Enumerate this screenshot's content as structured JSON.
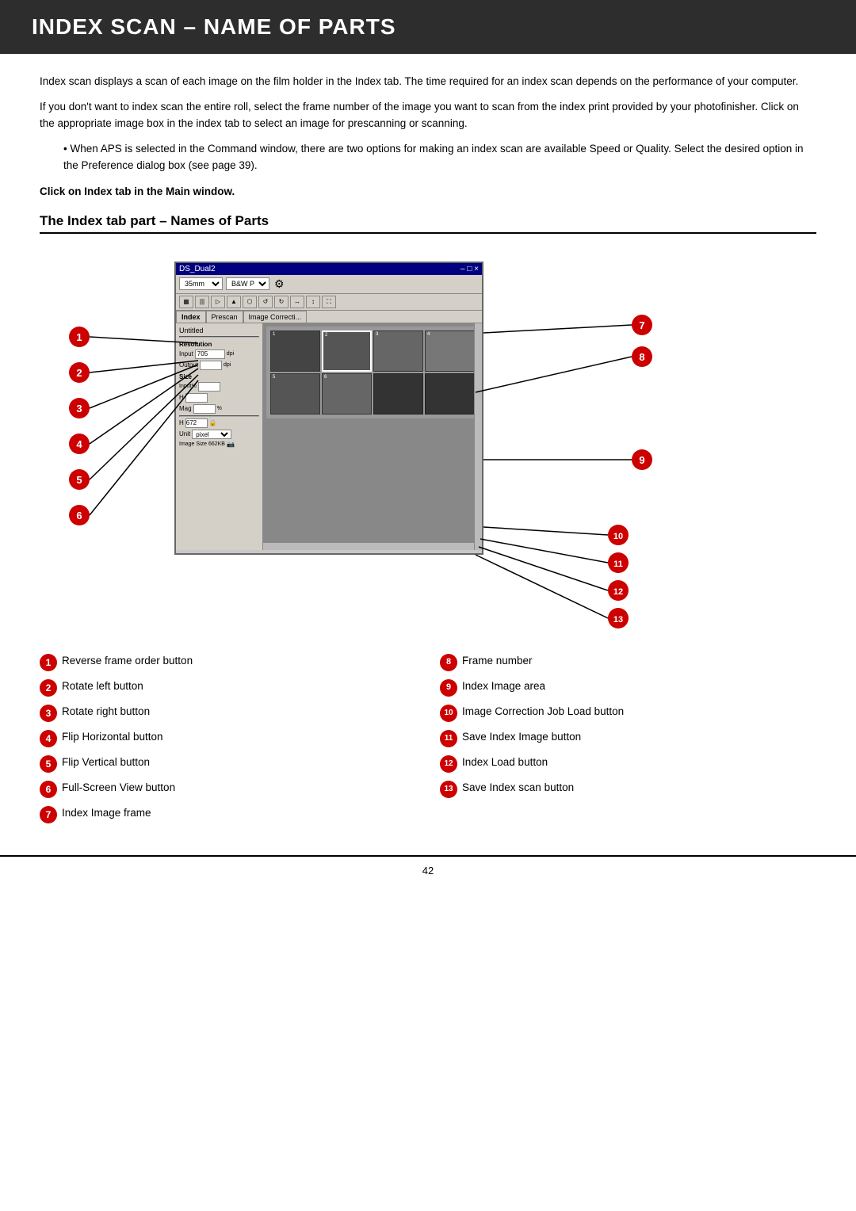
{
  "header": {
    "title": "INDEX SCAN – NAME OF PARTS"
  },
  "intro": {
    "paragraph1": "Index scan displays a scan of each image on the film holder in the Index tab. The time required for an index scan depends on the performance of your computer.",
    "paragraph2": "If you don't want to index scan the entire roll, select the frame number of the image you want to scan from the index print provided by your photofinisher. Click on the appropriate image box in the index tab to select an image for prescanning or scanning.",
    "bullet": "When APS is selected in the Command window, there are two options for making an index scan are available Speed or Quality. Select the desired option in the Preference dialog box (see page 39).",
    "click_instruction": "Click on Index tab in the Main window."
  },
  "section_title": "The Index tab part – Names of Parts",
  "scanner_window": {
    "title": "DS_Dual2",
    "controls": [
      "35mm",
      "B&W Positive"
    ],
    "tabs": [
      "Index",
      "Prescan",
      "Image Correcti..."
    ],
    "input_705": "705",
    "input_h": "672",
    "unit": "pixel",
    "image_size": "662KB"
  },
  "legend": {
    "items_left": [
      {
        "num": "1",
        "text": "Reverse frame order button"
      },
      {
        "num": "2",
        "text": "Rotate left button"
      },
      {
        "num": "3",
        "text": "Rotate right button"
      },
      {
        "num": "4",
        "text": "Flip Horizontal button"
      },
      {
        "num": "5",
        "text": "Flip Vertical button"
      },
      {
        "num": "6",
        "text": "Full-Screen View button"
      },
      {
        "num": "7",
        "text": "Index Image frame"
      }
    ],
    "items_right": [
      {
        "num": "8",
        "text": "Frame number"
      },
      {
        "num": "9",
        "text": "Index Image area"
      },
      {
        "num": "10",
        "text": "Image Correction Job Load button"
      },
      {
        "num": "11",
        "text": "Save Index Image button"
      },
      {
        "num": "12",
        "text": "Index Load button"
      },
      {
        "num": "13",
        "text": "Save Index scan button"
      }
    ]
  },
  "footer": {
    "page_number": "42"
  }
}
